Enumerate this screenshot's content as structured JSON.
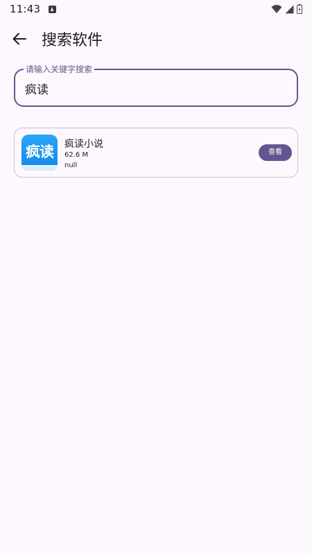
{
  "status_bar": {
    "time": "11:43",
    "icons": [
      "notification-icon",
      "wifi-icon",
      "signal-icon",
      "battery-charging-icon"
    ]
  },
  "app_bar": {
    "back_icon": "arrow-left-icon",
    "title": "搜索软件"
  },
  "search": {
    "label": "请输入关键字搜索",
    "value": "疯读"
  },
  "results": [
    {
      "icon_text": "疯读",
      "name": "疯读小说",
      "size": "62.6 M",
      "description": "null",
      "action_label": "查看"
    }
  ],
  "colors": {
    "primary": "#65558f",
    "background": "#fdf8fd",
    "card_border": "#cac4d0",
    "app_icon_blue": "#1e96f0"
  }
}
